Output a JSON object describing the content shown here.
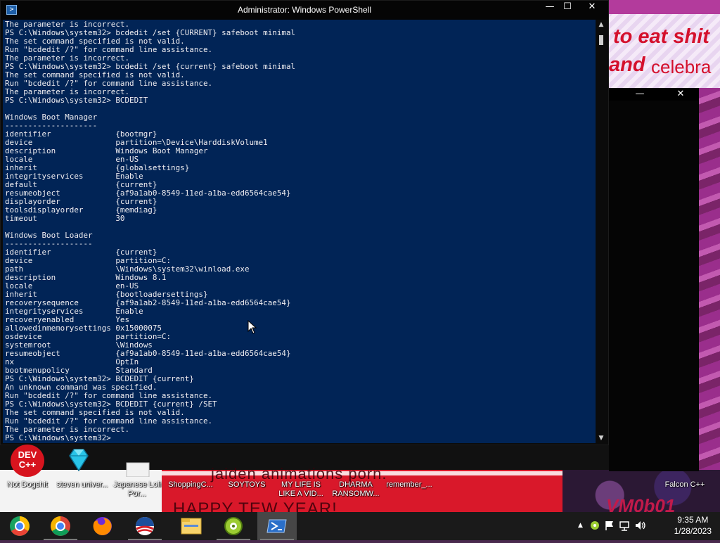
{
  "window": {
    "title": "Administrator: Windows PowerShell",
    "app_icon": "powershell-icon",
    "controls": {
      "minimize": "—",
      "maximize": "☐",
      "close": "✕"
    }
  },
  "console": {
    "lines": [
      "The parameter is incorrect.",
      "PS C:\\Windows\\system32> bcdedit /set {CURRENT} safeboot minimal",
      "The set command specified is not valid.",
      "Run \"bcdedit /?\" for command line assistance.",
      "The parameter is incorrect.",
      "PS C:\\Windows\\system32> bcdedit /set {current} safeboot minimal",
      "The set command specified is not valid.",
      "Run \"bcdedit /?\" for command line assistance.",
      "The parameter is incorrect.",
      "PS C:\\Windows\\system32> BCDEDIT",
      "",
      "Windows Boot Manager",
      "--------------------",
      "identifier              {bootmgr}",
      "device                  partition=\\Device\\HarddiskVolume1",
      "description             Windows Boot Manager",
      "locale                  en-US",
      "inherit                 {globalsettings}",
      "integrityservices       Enable",
      "default                 {current}",
      "resumeobject            {af9a1ab0-8549-11ed-a1ba-edd6564cae54}",
      "displayorder            {current}",
      "toolsdisplayorder       {memdiag}",
      "timeout                 30",
      "",
      "Windows Boot Loader",
      "-------------------",
      "identifier              {current}",
      "device                  partition=C:",
      "path                    \\Windows\\system32\\winload.exe",
      "description             Windows 8.1",
      "locale                  en-US",
      "inherit                 {bootloadersettings}",
      "recoverysequence        {af9a1ab2-8549-11ed-a1ba-edd6564cae54}",
      "integrityservices       Enable",
      "recoveryenabled         Yes",
      "allowedinmemorysettings 0x15000075",
      "osdevice                partition=C:",
      "systemroot              \\Windows",
      "resumeobject            {af9a1ab0-8549-11ed-a1ba-edd6564cae54}",
      "nx                      OptIn",
      "bootmenupolicy          Standard",
      "PS C:\\Windows\\system32> BCDEDIT {current}",
      "An unknown command was specified.",
      "Run \"bcdedit /?\" for command line assistance.",
      "PS C:\\Windows\\system32> BCDEDIT {current} /SET",
      "The set command specified is not valid.",
      "Run \"bcdedit /?\" for command line assistance.",
      "The parameter is incorrect.",
      "PS C:\\Windows\\system32>"
    ],
    "background": "#012456",
    "foreground": "#eeedf0"
  },
  "scrollbar": {
    "up": "▲",
    "down": "▼"
  },
  "back_window": {
    "minimize": "—",
    "close": "✕"
  },
  "wallpaper": {
    "text1": "to eat shit",
    "text2a": "and",
    "text2b": "celebra",
    "text3": "jaiden animations porn.",
    "text4": "HAPPY TEW YEAR!",
    "text5": "VM0b01"
  },
  "desktop_icons": [
    {
      "name": "dev-cpp-icon",
      "image_text": "DEV\nC++",
      "label": "Not Dogshit"
    },
    {
      "name": "gem-icon",
      "label": "steven univer..."
    },
    {
      "name": "document-icon",
      "label": "Japanese Loli Por..."
    },
    {
      "name": "file-icon",
      "label": "ShoppingC..."
    },
    {
      "name": "file-icon",
      "label": "SOYTOYS"
    },
    {
      "name": "file-icon",
      "label": "MY LIFE IS LIKE A VID..."
    },
    {
      "name": "file-icon",
      "label": "DHARMA RANSOMW..."
    },
    {
      "name": "file-icon",
      "label": "remember_..."
    },
    {
      "name": "file-icon",
      "label": "Falcon C++"
    }
  ],
  "taskbar": {
    "apps": [
      {
        "name": "chrome-os-style-icon",
        "label": "Start"
      },
      {
        "name": "chrome-icon",
        "label": "Google Chrome"
      },
      {
        "name": "firefox-icon",
        "label": "Firefox"
      },
      {
        "name": "obama-logo-icon",
        "label": "App"
      },
      {
        "name": "file-explorer-icon",
        "label": "File Explorer"
      },
      {
        "name": "green-disc-icon",
        "label": "App"
      },
      {
        "name": "powershell-icon",
        "label": "Windows PowerShell"
      }
    ],
    "tray": {
      "chevron": "▲",
      "time": "9:35 AM",
      "date": "1/28/2023"
    }
  },
  "colors": {
    "console_bg": "#012456",
    "taskbar_bg": "#1a1a1a",
    "active_task": "#474747",
    "wallpaper_red": "#d9182a"
  }
}
